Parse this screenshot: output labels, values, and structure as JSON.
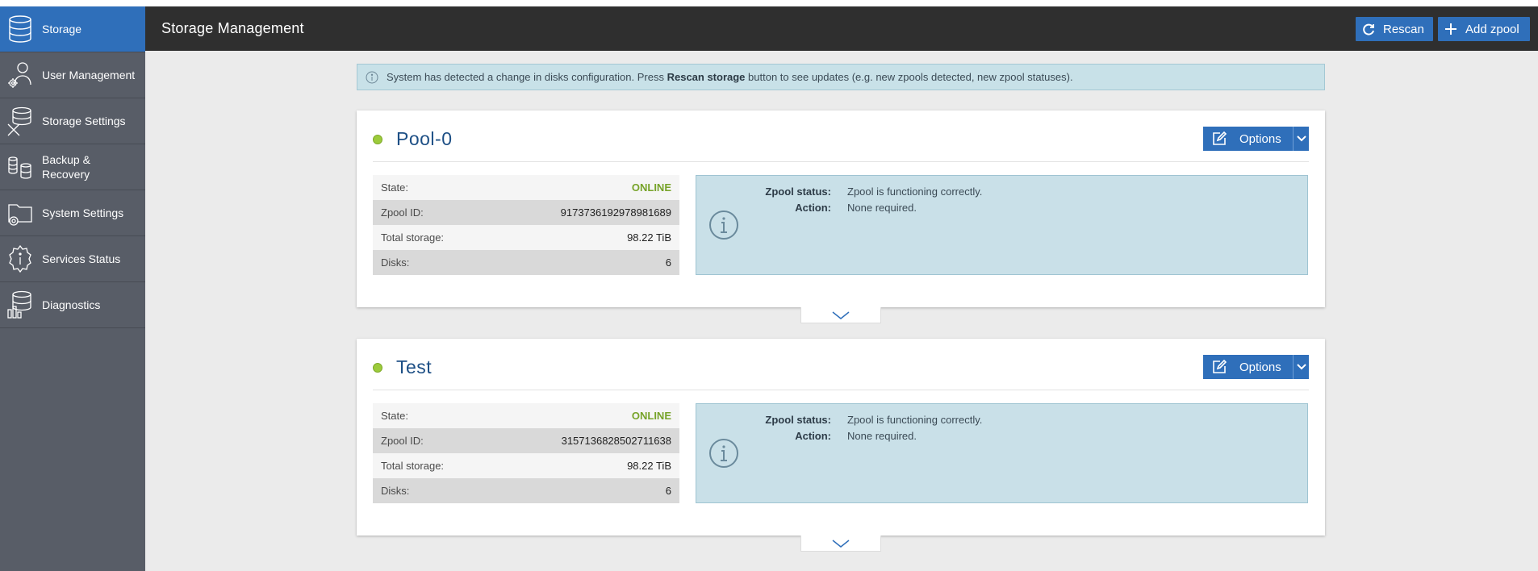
{
  "sidebar": {
    "items": [
      {
        "label": "Storage",
        "icon": "storage-db-icon",
        "active": true
      },
      {
        "label": "User Management",
        "icon": "user-gear-icon"
      },
      {
        "label": "Storage Settings",
        "icon": "storage-tools-icon"
      },
      {
        "label": "Backup & Recovery",
        "label_line1": "Backup &",
        "label_line2": "Recovery",
        "icon": "backup-icon"
      },
      {
        "label": "System Settings",
        "icon": "folder-gear-icon"
      },
      {
        "label": "Services Status",
        "icon": "info-gear-icon"
      },
      {
        "label": "Diagnostics",
        "icon": "diagnostics-icon"
      }
    ]
  },
  "header": {
    "title": "Storage Management",
    "rescan_label": "Rescan",
    "add_zpool_label": "Add zpool"
  },
  "alert": {
    "text_before": "System has detected a change in disks configuration. Press ",
    "bold": "Rescan storage",
    "text_after": " button to see updates (e.g. new zpools detected, new zpool statuses)."
  },
  "pools": [
    {
      "name": "Pool-0",
      "options_label": "Options",
      "rows": [
        {
          "label": "State:",
          "value": "ONLINE"
        },
        {
          "label": "Zpool ID:",
          "value": "9173736192978981689"
        },
        {
          "label": "Total storage:",
          "value": "98.22 TiB"
        },
        {
          "label": "Disks:",
          "value": "6"
        }
      ],
      "status_label": "Zpool status:",
      "status_value": "Zpool is functioning correctly.",
      "action_label": "Action:",
      "action_value": "None required."
    },
    {
      "name": "Test",
      "options_label": "Options",
      "rows": [
        {
          "label": "State:",
          "value": "ONLINE"
        },
        {
          "label": "Zpool ID:",
          "value": "3157136828502711638"
        },
        {
          "label": "Total storage:",
          "value": "98.22 TiB"
        },
        {
          "label": "Disks:",
          "value": "6"
        }
      ],
      "status_label": "Zpool status:",
      "status_value": "Zpool is functioning correctly.",
      "action_label": "Action:",
      "action_value": "None required."
    }
  ],
  "colors": {
    "accent": "#2f6fba",
    "online": "#77a329",
    "sidebar": "#585d67",
    "topbar": "#2f2f2f",
    "status_bg": "#c9e0e8"
  }
}
